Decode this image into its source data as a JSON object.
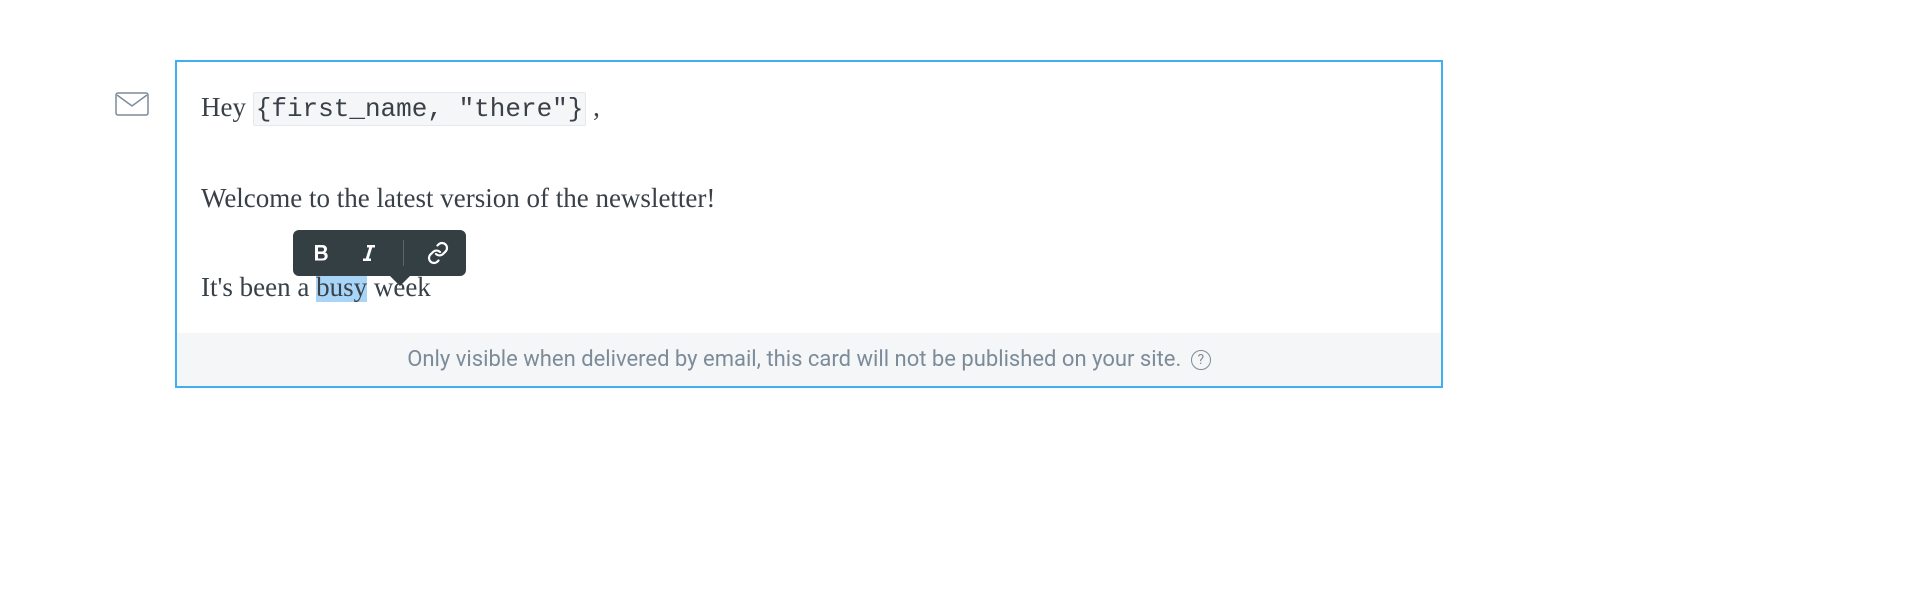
{
  "email_card": {
    "greeting_prefix": "Hey ",
    "placeholder_token": "{first_name, \"there\"}",
    "greeting_suffix": " ,",
    "welcome_line": "Welcome to the latest version of the newsletter!",
    "line3_before": "It's been a ",
    "line3_highlighted": "busy",
    "line3_after": " week",
    "footer_notice": "Only visible when delivered by email, this card will not be published on your site.",
    "help_symbol": "?"
  },
  "toolbar": {
    "bold_label": "Bold",
    "italic_label": "Italic",
    "link_label": "Link"
  }
}
